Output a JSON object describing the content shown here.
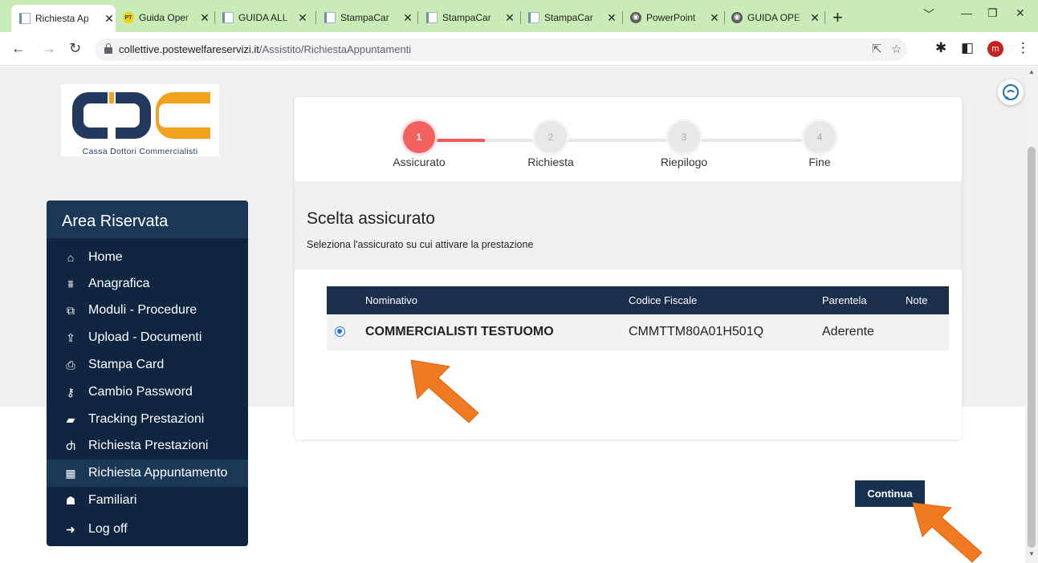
{
  "browser": {
    "tabs": [
      {
        "title": "Richiesta Ap",
        "icon": "document-favicon"
      },
      {
        "title": "Guida Oper",
        "icon": "pt-favicon"
      },
      {
        "title": "GUIDA ALL",
        "icon": "document-favicon"
      },
      {
        "title": "StampaCar",
        "icon": "document-favicon"
      },
      {
        "title": "StampaCar",
        "icon": "document-favicon"
      },
      {
        "title": "StampaCar",
        "icon": "document-favicon"
      },
      {
        "title": "PowerPoint",
        "icon": "globe-favicon"
      },
      {
        "title": "GUIDA OPE",
        "icon": "globe-favicon"
      }
    ],
    "pt_badge": "PT",
    "url_host": "collettive.postewelfareservizi.it",
    "url_path": "/Assistito/RichiestaAppuntamenti",
    "profile_initial": "m"
  },
  "logo": {
    "text": "Cassa Dottori Commercialisti"
  },
  "sidebar": {
    "title": "Area Riservata",
    "items": [
      {
        "label": "Home",
        "icon": "home-icon"
      },
      {
        "label": "Anagrafica",
        "icon": "bank-icon"
      },
      {
        "label": "Moduli - Procedure",
        "icon": "copy-icon"
      },
      {
        "label": "Upload - Documenti",
        "icon": "upload-icon"
      },
      {
        "label": "Stampa Card",
        "icon": "print-icon"
      },
      {
        "label": "Cambio Password",
        "icon": "key-icon"
      },
      {
        "label": "Tracking Prestazioni",
        "icon": "book-icon"
      },
      {
        "label": "Richiesta Prestazioni",
        "icon": "stethoscope-icon"
      },
      {
        "label": "Richiesta Appuntamento",
        "icon": "calendar-icon"
      },
      {
        "label": "Familiari",
        "icon": "users-icon"
      },
      {
        "label": "Log off",
        "icon": "sign-out-icon"
      }
    ],
    "active_index": 8
  },
  "stepper": {
    "steps": [
      {
        "number": "1",
        "label": "Assicurato"
      },
      {
        "number": "2",
        "label": "Richiesta"
      },
      {
        "number": "3",
        "label": "Riepilogo"
      },
      {
        "number": "4",
        "label": "Fine"
      }
    ],
    "current": 1
  },
  "section": {
    "title": "Scelta assicurato",
    "subtitle": "Seleziona l'assicurato su cui attivare la prestazione"
  },
  "table": {
    "headers": [
      "Nominativo",
      "Codice Fiscale",
      "Parentela",
      "Note"
    ],
    "rows": [
      {
        "nominativo": "COMMERCIALISTI TESTUOMO",
        "codice_fiscale": "CMMTTM80A01H501Q",
        "parentela": "Aderente",
        "note": "",
        "selected": true
      }
    ]
  },
  "actions": {
    "continue_label": "Continua"
  },
  "colors": {
    "accent_step": "#f2605f",
    "navy": "#0f2540",
    "table_header": "#1b2f4c",
    "tabbar": "#c9ebb6",
    "arrow": "#f07a22"
  }
}
